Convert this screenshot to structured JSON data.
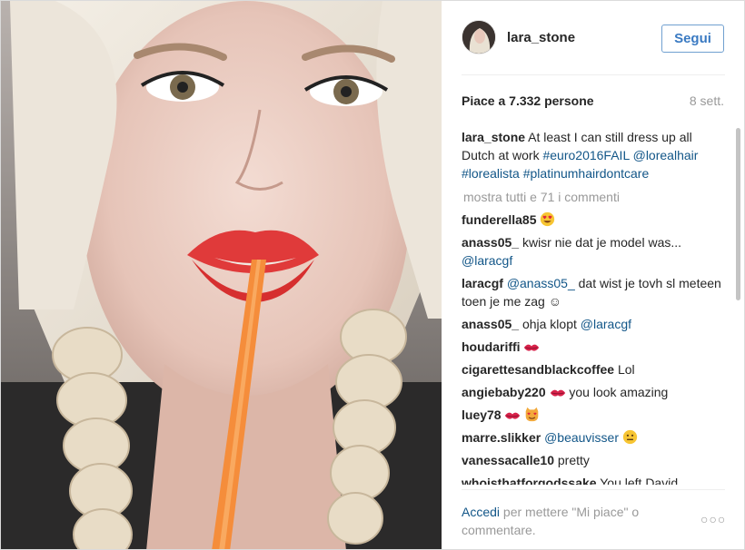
{
  "post": {
    "username": "lara_stone",
    "follow_label": "Segui",
    "likes_text": "Piace a 7.332 persone",
    "age_text": "8 sett."
  },
  "caption": {
    "username": "lara_stone",
    "text": "At least I can still dress up all Dutch at work",
    "hashtag1": "#euro2016FAIL",
    "mention": "@lorealhair",
    "hashtag2": "#lorealista",
    "hashtag3": "#platinumhairdontcare"
  },
  "show_all_comments": "mostra tutti e 71 i commenti",
  "comments": [
    {
      "user": "funderella85",
      "text": ""
    },
    {
      "user": "anass05_",
      "text": "kwisr nie dat je model was...",
      "mention": "@laracgf"
    },
    {
      "user": "laracgf",
      "mention": "@anass05_",
      "text": "dat wist je tovh sl meteen toen je me zag ☺"
    },
    {
      "user": "anass05_",
      "text": "ohja klopt",
      "mention": "@laracgf"
    },
    {
      "user": "houdariffi",
      "text": ""
    },
    {
      "user": "cigarettesandblackcoffee",
      "text": "Lol"
    },
    {
      "user": "angiebaby220",
      "text": "you look amazing"
    },
    {
      "user": "luey78",
      "text": ""
    },
    {
      "user": "marre.slikker",
      "mention": "@beauvisser",
      "text": ""
    },
    {
      "user": "vanessacalle10",
      "text": "pretty"
    },
    {
      "user": "whoisthatforgodssake",
      "text": "You left David"
    }
  ],
  "footer": {
    "login_link": "Accedi",
    "rest": "per mettere \"Mi piace\" o commentare.",
    "more_options": "○○○"
  },
  "icons": {
    "heart_eyes": "heart-eyes-emoji",
    "kiss": "kiss-mark-emoji",
    "cat_heart_eyes": "heart-eyes-cat-emoji",
    "neutral": "neutral-face-emoji"
  },
  "colors": {
    "link": "#125688",
    "follow": "#3a7ac2",
    "muted": "#999999"
  }
}
